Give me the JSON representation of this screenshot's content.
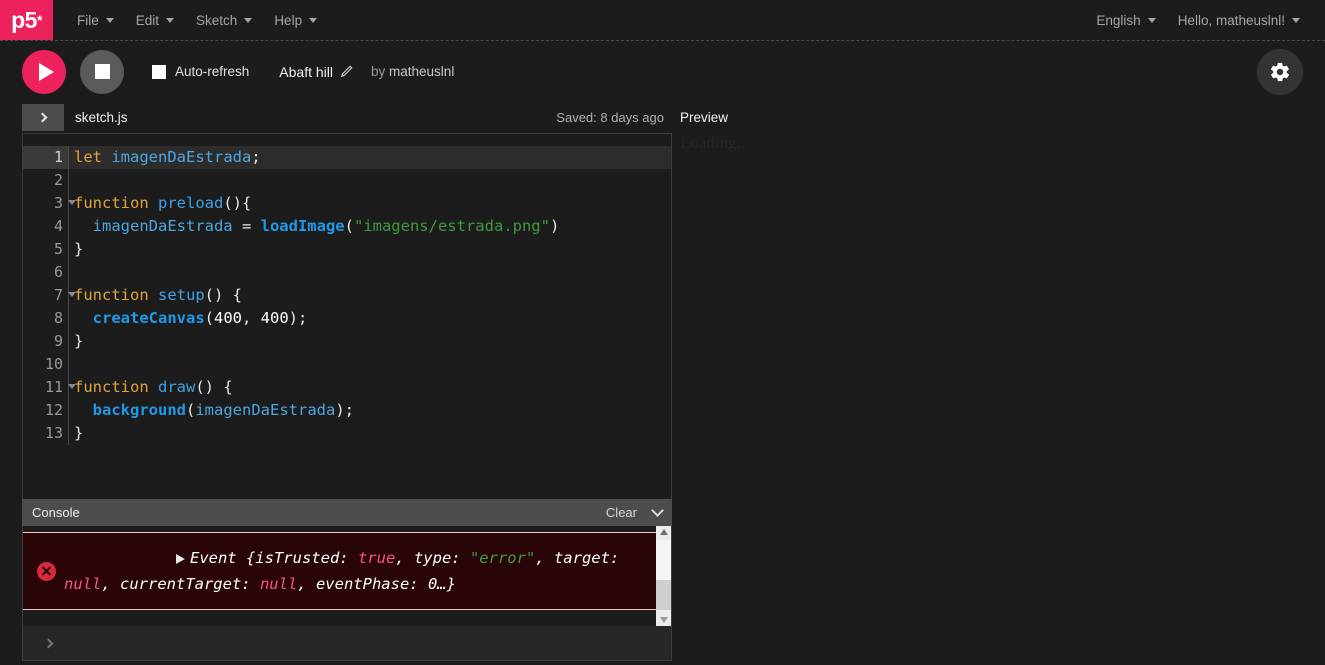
{
  "nav": {
    "logo": "p5",
    "logo_star": "*",
    "menus": [
      {
        "label": "File"
      },
      {
        "label": "Edit"
      },
      {
        "label": "Sketch"
      },
      {
        "label": "Help"
      }
    ],
    "language": "English",
    "greeting": "Hello, matheuslnl!"
  },
  "toolbar": {
    "play_label": "play",
    "stop_label": "stop",
    "autorefresh_label": "Auto-refresh",
    "autorefresh_checked": true,
    "sketch_name": "Abaft hill",
    "by_prefix": "by",
    "author": "matheuslnl",
    "settings_label": "settings"
  },
  "file_bar": {
    "toggle_label": "Open file navigation",
    "file_name": "sketch.js",
    "saved_status": "Saved: 8 days ago"
  },
  "preview": {
    "label": "Preview",
    "content": "Loading..."
  },
  "editor": {
    "active_line": 1,
    "lines": [
      {
        "n": "1",
        "fold": false,
        "tokens": [
          {
            "t": "let",
            "c": "tk-kw"
          },
          {
            "t": " ",
            "c": "tk-pun"
          },
          {
            "t": "imagenDaEstrada",
            "c": "tk-var"
          },
          {
            "t": ";",
            "c": "tk-pun"
          }
        ]
      },
      {
        "n": "2",
        "fold": false,
        "tokens": []
      },
      {
        "n": "3",
        "fold": true,
        "tokens": [
          {
            "t": "function",
            "c": "tk-kw"
          },
          {
            "t": " ",
            "c": "tk-pun"
          },
          {
            "t": "preload",
            "c": "tk-fn"
          },
          {
            "t": "(){",
            "c": "tk-pun"
          }
        ]
      },
      {
        "n": "4",
        "fold": false,
        "tokens": [
          {
            "t": "  imagenDaEstrada",
            "c": "tk-var"
          },
          {
            "t": " = ",
            "c": "tk-pun"
          },
          {
            "t": "loadImage",
            "c": "tk-bfn"
          },
          {
            "t": "(",
            "c": "tk-pun"
          },
          {
            "t": "\"imagens/estrada.png\"",
            "c": "tk-str"
          },
          {
            "t": ")",
            "c": "tk-pun"
          }
        ]
      },
      {
        "n": "5",
        "fold": false,
        "tokens": [
          {
            "t": "}",
            "c": "tk-pun"
          }
        ]
      },
      {
        "n": "6",
        "fold": false,
        "tokens": []
      },
      {
        "n": "7",
        "fold": true,
        "tokens": [
          {
            "t": "function",
            "c": "tk-kw"
          },
          {
            "t": " ",
            "c": "tk-pun"
          },
          {
            "t": "setup",
            "c": "tk-fn"
          },
          {
            "t": "() {",
            "c": "tk-pun"
          }
        ]
      },
      {
        "n": "8",
        "fold": false,
        "tokens": [
          {
            "t": "  ",
            "c": "tk-pun"
          },
          {
            "t": "createCanvas",
            "c": "tk-bfn"
          },
          {
            "t": "(",
            "c": "tk-pun"
          },
          {
            "t": "400",
            "c": "tk-num"
          },
          {
            "t": ", ",
            "c": "tk-pun"
          },
          {
            "t": "400",
            "c": "tk-num"
          },
          {
            "t": ");",
            "c": "tk-pun"
          }
        ]
      },
      {
        "n": "9",
        "fold": false,
        "tokens": [
          {
            "t": "}",
            "c": "tk-pun"
          }
        ]
      },
      {
        "n": "10",
        "fold": false,
        "tokens": []
      },
      {
        "n": "11",
        "fold": true,
        "tokens": [
          {
            "t": "function",
            "c": "tk-kw"
          },
          {
            "t": " ",
            "c": "tk-pun"
          },
          {
            "t": "draw",
            "c": "tk-fn"
          },
          {
            "t": "() {",
            "c": "tk-pun"
          }
        ]
      },
      {
        "n": "12",
        "fold": false,
        "tokens": [
          {
            "t": "  ",
            "c": "tk-pun"
          },
          {
            "t": "background",
            "c": "tk-bfn"
          },
          {
            "t": "(",
            "c": "tk-pun"
          },
          {
            "t": "imagenDaEstrada",
            "c": "tk-var"
          },
          {
            "t": ");",
            "c": "tk-pun"
          }
        ]
      },
      {
        "n": "13",
        "fold": false,
        "tokens": [
          {
            "t": "}",
            "c": "tk-pun"
          }
        ]
      }
    ]
  },
  "console": {
    "title": "Console",
    "clear_label": "Clear",
    "collapse_label": "collapse console",
    "message": {
      "severity": "error",
      "segments": [
        {
          "t": "Event {isTrusted: ",
          "c": ""
        },
        {
          "t": "true",
          "c": "e-true"
        },
        {
          "t": ", type: ",
          "c": ""
        },
        {
          "t": "\"error\"",
          "c": "e-str"
        },
        {
          "t": ", target: ",
          "c": ""
        },
        {
          "t": "null",
          "c": "e-null"
        },
        {
          "t": ", currentTarget: ",
          "c": ""
        },
        {
          "t": "null",
          "c": "e-null"
        },
        {
          "t": ", eventPhase: 0…}",
          "c": ""
        }
      ]
    }
  },
  "colors": {
    "brand_pink": "#ed225d",
    "nav_bg": "#1c1c1c",
    "editor_bg": "#1c1c1c",
    "console_header_bg": "#4d4d4d",
    "error_bg": "#2a0507",
    "error_icon": "#d62b39"
  }
}
